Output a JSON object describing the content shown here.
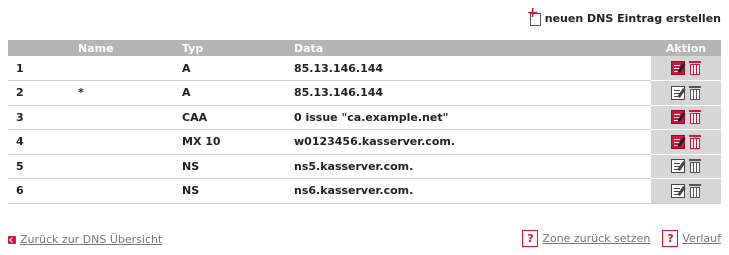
{
  "header": {
    "add_entry_label": "neuen DNS Eintrag erstellen",
    "add_icon": "new-document-icon"
  },
  "table": {
    "columns": [
      "",
      "Name",
      "Typ",
      "Data",
      "Aktion"
    ],
    "rows": [
      {
        "id": "1",
        "name": "",
        "typ": "A",
        "data": "85.13.146.144",
        "editable": true
      },
      {
        "id": "2",
        "name": "*",
        "typ": "A",
        "data": "85.13.146.144",
        "editable": false
      },
      {
        "id": "3",
        "name": "",
        "typ": "CAA",
        "data": "0 issue \"ca.example.net\"",
        "editable": true
      },
      {
        "id": "4",
        "name": "",
        "typ": "MX 10",
        "data": "w0123456.kasserver.com.",
        "editable": true
      },
      {
        "id": "5",
        "name": "",
        "typ": "NS",
        "data": "ns5.kasserver.com.",
        "editable": false
      },
      {
        "id": "6",
        "name": "",
        "typ": "NS",
        "data": "ns6.kasserver.com.",
        "editable": false
      }
    ]
  },
  "footer": {
    "back_link": "Zurück zur DNS Übersicht",
    "reset_zone_link": "Zone zurück setzen",
    "history_link": "Verlauf",
    "help_glyph": "?"
  },
  "colors": {
    "accent": "#d1163d",
    "header_bg": "#b5b5b5",
    "action_bg": "#d6d6d6"
  }
}
